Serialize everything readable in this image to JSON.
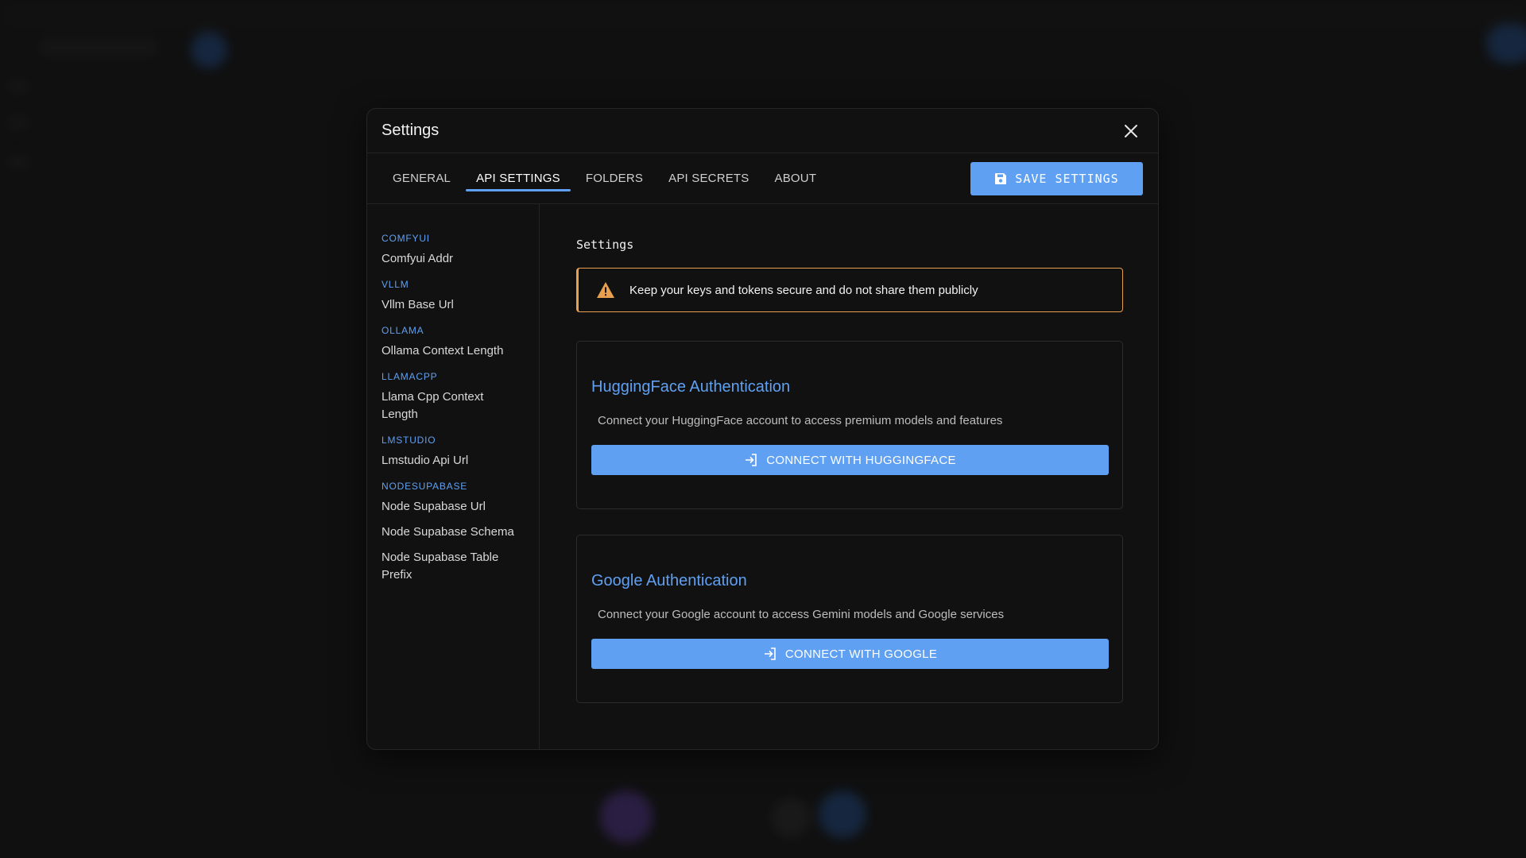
{
  "dialog": {
    "title": "Settings"
  },
  "tabs": [
    {
      "label": "GENERAL",
      "active": false
    },
    {
      "label": "API SETTINGS",
      "active": true
    },
    {
      "label": "FOLDERS",
      "active": false
    },
    {
      "label": "API SECRETS",
      "active": false
    },
    {
      "label": "ABOUT",
      "active": false
    }
  ],
  "save_button": {
    "label": "SAVE SETTINGS",
    "icon": "floppy-disk-icon"
  },
  "sidebar": {
    "sections": [
      {
        "heading": "COMFYUI",
        "items": [
          "Comfyui Addr"
        ]
      },
      {
        "heading": "VLLM",
        "items": [
          "Vllm Base Url"
        ]
      },
      {
        "heading": "OLLAMA",
        "items": [
          "Ollama Context Length"
        ]
      },
      {
        "heading": "LLAMACPP",
        "items": [
          "Llama Cpp Context Length"
        ]
      },
      {
        "heading": "LMSTUDIO",
        "items": [
          "Lmstudio Api Url"
        ]
      },
      {
        "heading": "NODESUPABASE",
        "items": [
          "Node Supabase Url",
          "Node Supabase Schema",
          "Node Supabase Table Prefix"
        ]
      }
    ]
  },
  "main": {
    "title": "Settings",
    "alert": {
      "text": "Keep your keys and tokens secure and do not share them publicly",
      "icon": "warning-icon"
    },
    "cards": [
      {
        "title": "HuggingFace Authentication",
        "description": "Connect your HuggingFace account to access premium models and features",
        "button": "CONNECT WITH HUGGINGFACE"
      },
      {
        "title": "Google Authentication",
        "description": "Connect your Google account to access Gemini models and Google services",
        "button": "CONNECT WITH GOOGLE"
      }
    ]
  },
  "colors": {
    "accent": "#5fa0f2",
    "warning": "#e8a050",
    "dialog_bg": "#111111"
  }
}
